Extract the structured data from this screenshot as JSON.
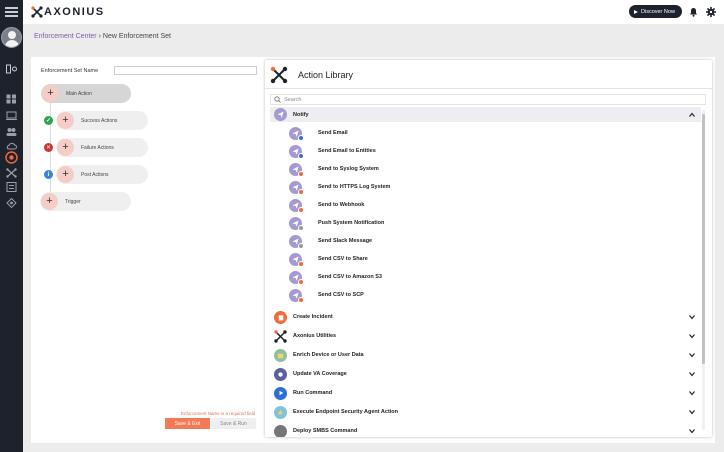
{
  "app": {
    "brand": "AXONIUS"
  },
  "header": {
    "discover_label": "Discover Now"
  },
  "breadcrumb": {
    "root": "Enforcement Center",
    "separator": "›",
    "current": "New Enforcement Set"
  },
  "form": {
    "set_name_label": "Enforcement Set Name",
    "set_name_value": "",
    "main_action": "Main Action",
    "success_actions": "Success Actions",
    "failure_actions": "Failure Actions",
    "post_actions": "Post Actions",
    "trigger": "Trigger",
    "error_message": "Enforcement Name is a required field",
    "save_exit": "Save & Exit",
    "save_run": "Save & Run"
  },
  "library": {
    "title": "Action Library",
    "search_placeholder": "Search",
    "categories": [
      {
        "label": "Notify",
        "icon": "paper-plane-icon",
        "color": "#a59ad1",
        "expanded": true
      },
      {
        "label": "Create Incident",
        "icon": "clipboard-icon",
        "color": "#f26b3a"
      },
      {
        "label": "Axonius Utilities",
        "icon": "axonius-icon",
        "color": "#1d222c"
      },
      {
        "label": "Enrich Device or User Data",
        "icon": "enrich-icon",
        "color": "#8fbf9e"
      },
      {
        "label": "Update VA Coverage",
        "icon": "va-coverage-icon",
        "color": "#5c5f9e"
      },
      {
        "label": "Run Command",
        "icon": "play-icon",
        "color": "#2d6fd6"
      },
      {
        "label": "Execute Endpoint Security Agent Action",
        "icon": "endpoint-icon",
        "color": "#7fc4d8"
      },
      {
        "label": "Deploy SMBS Command",
        "icon": "smb-icon",
        "color": "#777777"
      }
    ],
    "notify_actions": [
      {
        "label": "Send Email",
        "badge_color": "#3b6fd6"
      },
      {
        "label": "Send Email to Entities",
        "badge_color": "#3b6fd6"
      },
      {
        "label": "Send to Syslog System",
        "badge_color": "#f26b3a"
      },
      {
        "label": "Send to HTTPS Log System",
        "badge_color": "#f26b3a"
      },
      {
        "label": "Send to Webhook",
        "badge_color": "#f26b3a"
      },
      {
        "label": "Push System Notification",
        "badge_color": "#9a9a9a"
      },
      {
        "label": "Send Slack Message",
        "badge_color": "#9a9a9a"
      },
      {
        "label": "Send CSV to Share",
        "badge_color": "#f26b3a"
      },
      {
        "label": "Send CSV to Amazon S3",
        "badge_color": "#f26b3a"
      },
      {
        "label": "Send CSV to SCP",
        "badge_color": "#f26b3a"
      }
    ]
  }
}
